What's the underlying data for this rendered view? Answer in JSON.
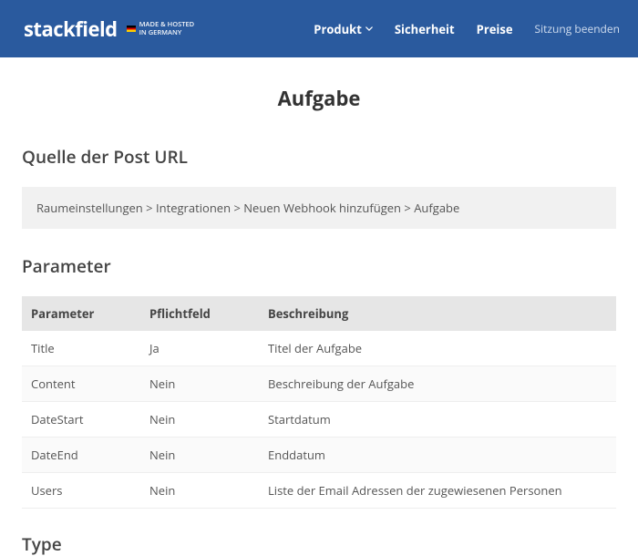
{
  "header": {
    "logo": "stackfield",
    "tagline_line1": "MADE & HOSTED",
    "tagline_line2": "IN GERMANY",
    "nav": {
      "produkt": "Produkt",
      "sicherheit": "Sicherheit",
      "preise": "Preise",
      "logout": "Sitzung beenden"
    }
  },
  "page": {
    "title": "Aufgabe",
    "section_source": "Quelle der Post URL",
    "breadcrumb": "Raumeinstellungen > Integrationen > Neuen Webhook hinzufügen > Aufgabe",
    "section_parameter": "Parameter",
    "section_type": "Type",
    "table": {
      "head": {
        "parameter": "Parameter",
        "required": "Pflichtfeld",
        "description": "Beschreibung"
      },
      "rows": [
        {
          "parameter": "Title",
          "required": "Ja",
          "description": "Titel der Aufgabe"
        },
        {
          "parameter": "Content",
          "required": "Nein",
          "description": "Beschreibung der Aufgabe"
        },
        {
          "parameter": "DateStart",
          "required": "Nein",
          "description": "Startdatum"
        },
        {
          "parameter": "DateEnd",
          "required": "Nein",
          "description": "Enddatum"
        },
        {
          "parameter": "Users",
          "required": "Nein",
          "description": "Liste der Email Adressen der zugewiesenen Personen"
        }
      ]
    }
  }
}
